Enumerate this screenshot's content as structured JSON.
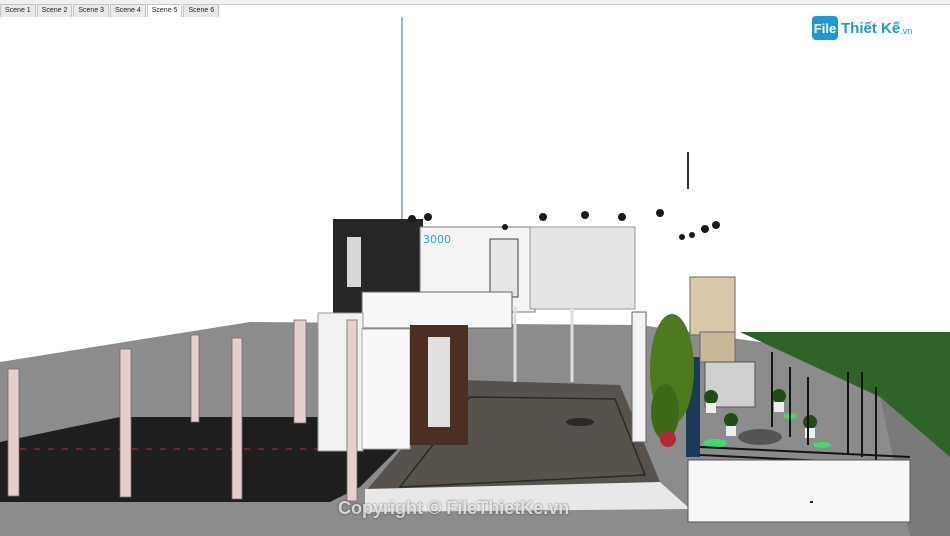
{
  "scene_tabs": [
    {
      "label": "Scene 1",
      "active": false
    },
    {
      "label": "Scene 2",
      "active": false
    },
    {
      "label": "Scene 3",
      "active": false
    },
    {
      "label": "Scene 4",
      "active": false
    },
    {
      "label": "Scene 5",
      "active": true
    },
    {
      "label": "Scene 6",
      "active": false
    }
  ],
  "viewport": {
    "dimension_label": "3000"
  },
  "logo": {
    "mark": "File",
    "text": "Thiết Kế",
    "suffix": ".vn"
  },
  "watermark": {
    "text": "Copyright © FileThietKe.vn"
  },
  "colors": {
    "ground": "#8a8a8a",
    "pavement_dark": "#1f1f1f",
    "driveway": "#5a5650",
    "grass": "#2f6a2a",
    "accent": "#1a9ad6"
  }
}
